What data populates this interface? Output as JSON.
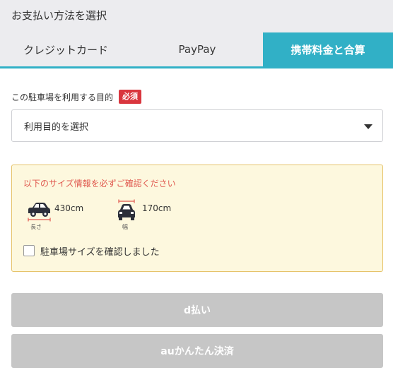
{
  "header": {
    "title": "お支払い方法を選択"
  },
  "tabs": [
    {
      "label": "クレジットカード",
      "active": false
    },
    {
      "label": "PayPay",
      "active": false
    },
    {
      "label": "携帯料金と合算",
      "active": true
    }
  ],
  "purpose": {
    "label": "この駐車場を利用する目的",
    "required_badge": "必須",
    "select_value": "利用目的を選択"
  },
  "size_notice": {
    "title": "以下のサイズ情報を必ずご確認ください",
    "length": {
      "value": "430cm",
      "caption": "長さ",
      "icon": "car-side-length-icon"
    },
    "width": {
      "value": "170cm",
      "caption": "幅",
      "icon": "car-front-width-icon"
    },
    "confirm_label": "駐車場サイズを確認しました",
    "confirm_checked": false
  },
  "buttons": {
    "d_pay": "d払い",
    "au_pay": "auかんたん決済"
  },
  "colors": {
    "accent": "#31b0c6",
    "required": "#d9363e",
    "notice_bg": "#fdf8de",
    "notice_border": "#e6c36a",
    "notice_title": "#e0594f",
    "button_disabled": "#c6c6c6"
  }
}
